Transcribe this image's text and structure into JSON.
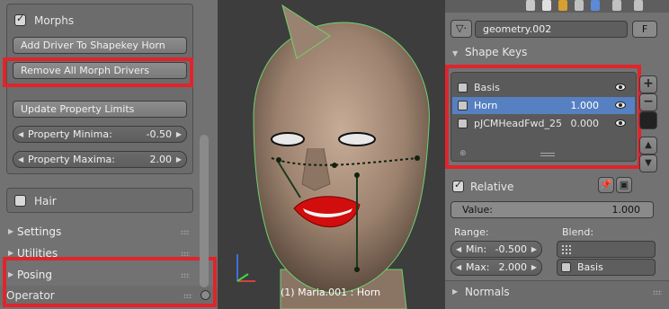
{
  "left_panel": {
    "morphs_label": "Morphs",
    "add_driver_label": "Add Driver To Shapekey Horn",
    "remove_drivers_label": "Remove All Morph Drivers",
    "update_limits_label": "Update Property Limits",
    "property_minima": {
      "label": "Property Minima:",
      "value": "-0.50"
    },
    "property_maxima": {
      "label": "Property Maxima:",
      "value": "2.00"
    },
    "hair_label": "Hair",
    "sections": [
      "Settings",
      "Utilities",
      "Posing"
    ],
    "operator_label": "Operator"
  },
  "viewport": {
    "object_label": "(1) Maria.001 : Horn"
  },
  "right_panel": {
    "mesh_name": "geometry.002",
    "fake_user_label": "F",
    "shape_keys_title": "Shape Keys",
    "shape_keys": [
      {
        "name": "Basis",
        "value": ""
      },
      {
        "name": "Horn",
        "value": "1.000"
      },
      {
        "name": "pJCMHeadFwd_25",
        "value": "0.000"
      }
    ],
    "relative_label": "Relative",
    "value_field": {
      "label": "Value:",
      "value": "1.000"
    },
    "range_label": "Range:",
    "min_field": {
      "label": "Min:",
      "value": "-0.500"
    },
    "max_field": {
      "label": "Max:",
      "value": "2.000"
    },
    "blend_label": "Blend:",
    "blend_value": "Basis",
    "normals_label": "Normals"
  },
  "colors": {
    "highlight_red": "#e0242b",
    "selected_row": "#5680c2",
    "skin": "#a88d78",
    "lips": "#d10d0d"
  }
}
